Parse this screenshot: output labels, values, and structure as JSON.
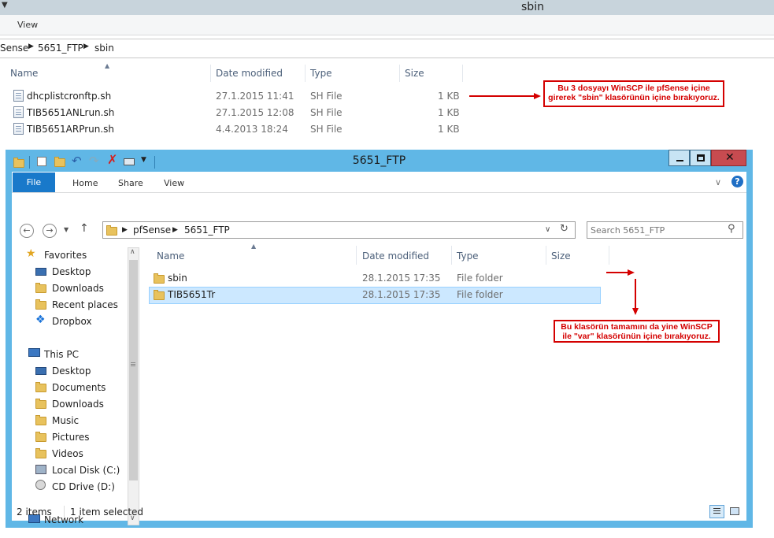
{
  "background_window": {
    "title": "sbin",
    "ribbon_tab": "View",
    "breadcrumb": [
      "Sense",
      "5651_FTP",
      "sbin"
    ],
    "columns": [
      "Name",
      "Date modified",
      "Type",
      "Size"
    ],
    "files": [
      {
        "name": "dhcplistcronftp.sh",
        "date": "27.1.2015 11:41",
        "type": "SH File",
        "size": "1 KB"
      },
      {
        "name": "TIB5651ANLrun.sh",
        "date": "27.1.2015 12:08",
        "type": "SH File",
        "size": "1 KB"
      },
      {
        "name": "TIB5651ARPrun.sh",
        "date": "4.4.2013 18:24",
        "type": "SH File",
        "size": "1 KB"
      }
    ]
  },
  "annotations": {
    "note_top": [
      "Bu 3 dosyayı WinSCP ile pfSense içine",
      "girerek \"sbin\" klasörünün içine bırakıyoruz."
    ],
    "note_bottom": [
      "Bu klasörün tamamını da yine WinSCP",
      "ile \"var\" klasörünün içine bırakıyoruz."
    ]
  },
  "window": {
    "title": "5651_FTP",
    "ribbon_tabs": {
      "file": "File",
      "home": "Home",
      "share": "Share",
      "view": "View"
    },
    "breadcrumb": [
      "pfSense",
      "5651_FTP"
    ],
    "search_placeholder": "Search 5651_FTP",
    "columns": [
      "Name",
      "Date modified",
      "Type",
      "Size"
    ],
    "items": [
      {
        "name": "sbin",
        "date": "28.1.2015 17:35",
        "type": "File folder",
        "size": ""
      },
      {
        "name": "TIB5651Tr",
        "date": "28.1.2015 17:35",
        "type": "File folder",
        "size": ""
      }
    ],
    "selected_index": 1,
    "nav": {
      "favorites_label": "Favorites",
      "favorites": [
        "Desktop",
        "Downloads",
        "Recent places",
        "Dropbox"
      ],
      "thispc_label": "This PC",
      "thispc": [
        "Desktop",
        "Documents",
        "Downloads",
        "Music",
        "Pictures",
        "Videos",
        "Local Disk (C:)",
        "CD Drive (D:)"
      ],
      "network_label": "Network"
    },
    "status": {
      "items": "2 items",
      "selected": "1 item selected"
    }
  },
  "colors": {
    "accent": "#1979ca",
    "titlebar": "#60b7e6",
    "annotation": "#d40000",
    "selection": "#cce8ff"
  }
}
